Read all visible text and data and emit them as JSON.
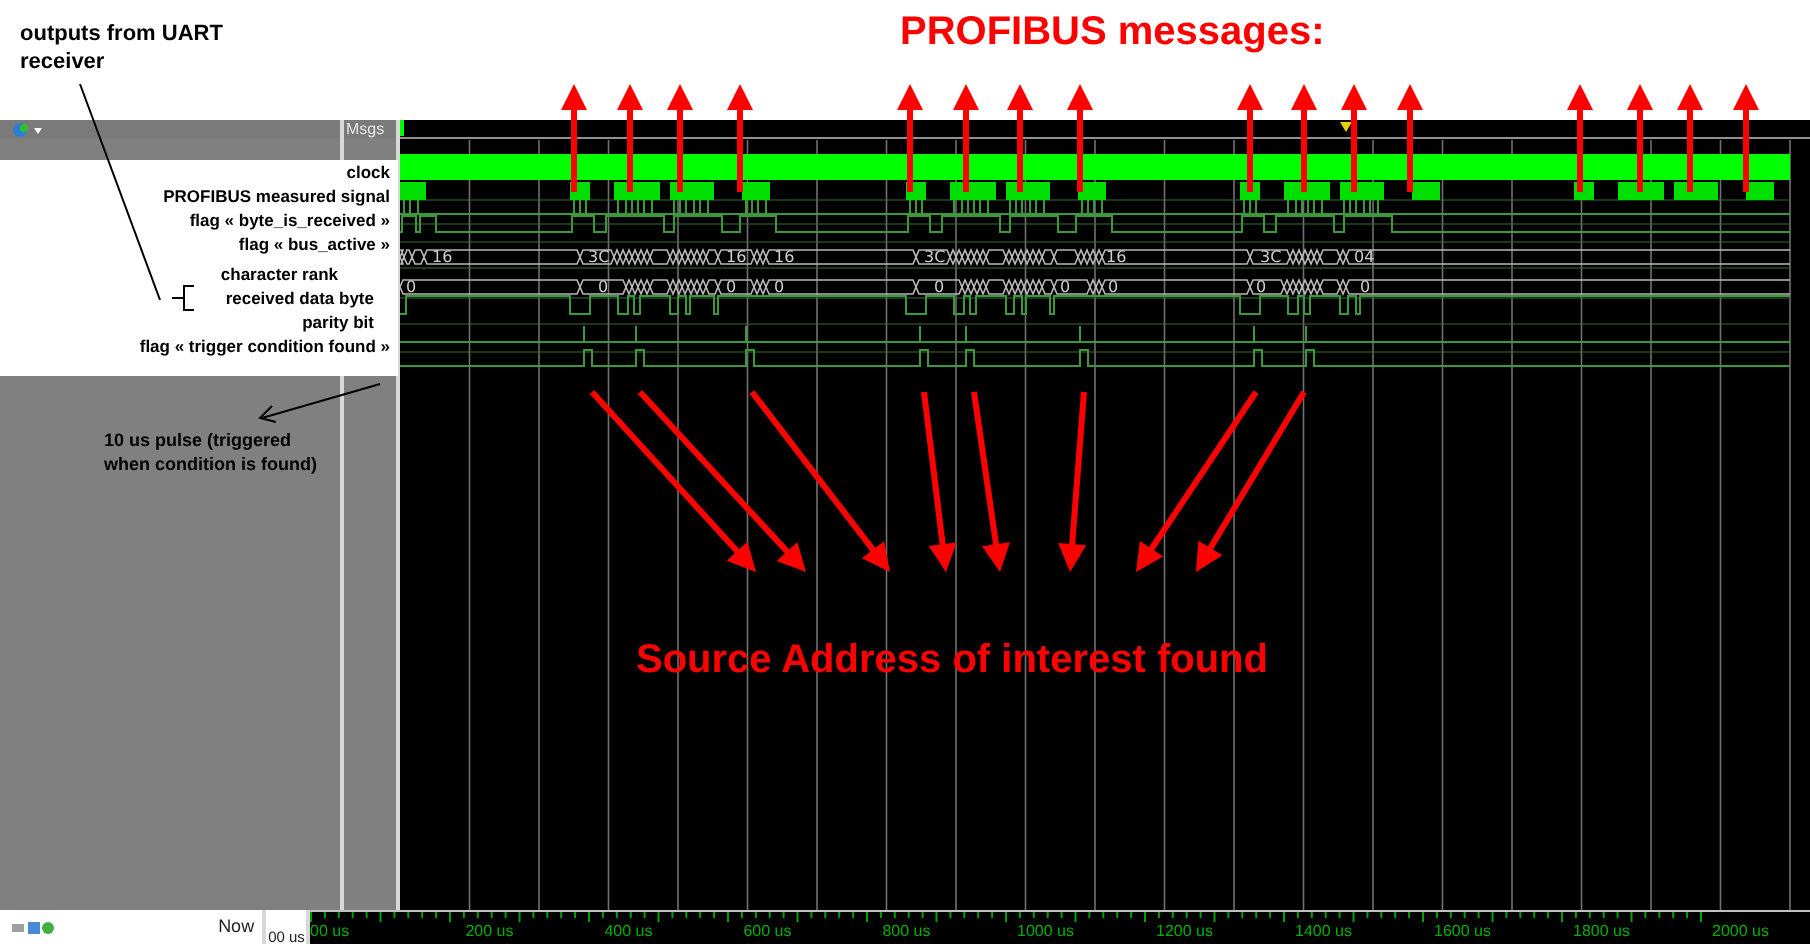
{
  "annotations": {
    "uart_note": "outputs from UART receiver",
    "messages_title": "PROFIBUS messages:",
    "found_note": "Source Address of interest found",
    "pulse_note": "10 us pulse (triggered when condition is found)"
  },
  "wave_window": {
    "msgs_header": "Msgs",
    "now_label": "Now",
    "cursor_time": "00 us"
  },
  "signals": [
    {
      "label": "clock",
      "kind": "clock"
    },
    {
      "label": "PROFIBUS measured signal",
      "kind": "burst"
    },
    {
      "label": "flag « byte_is_received »",
      "kind": "spikes"
    },
    {
      "label": "flag « bus_active »",
      "kind": "level"
    },
    {
      "label": "character rank",
      "kind": "bus",
      "values": [
        "16",
        "3C",
        "16",
        "16",
        "3C",
        "16",
        "3C",
        "04"
      ]
    },
    {
      "label": "received data byte",
      "kind": "bus",
      "values": [
        "0",
        "0",
        "0",
        "0",
        "0",
        "0",
        "0",
        "0",
        "0"
      ]
    },
    {
      "label": "parity bit",
      "kind": "parity"
    },
    {
      "label": "flag « trigger condition found »",
      "kind": "trigger"
    }
  ],
  "timeline": [
    "00 us",
    "200 us",
    "400 us",
    "600 us",
    "800 us",
    "1000 us",
    "1200 us",
    "1400 us",
    "1600 us",
    "1800 us",
    "2000 us"
  ]
}
